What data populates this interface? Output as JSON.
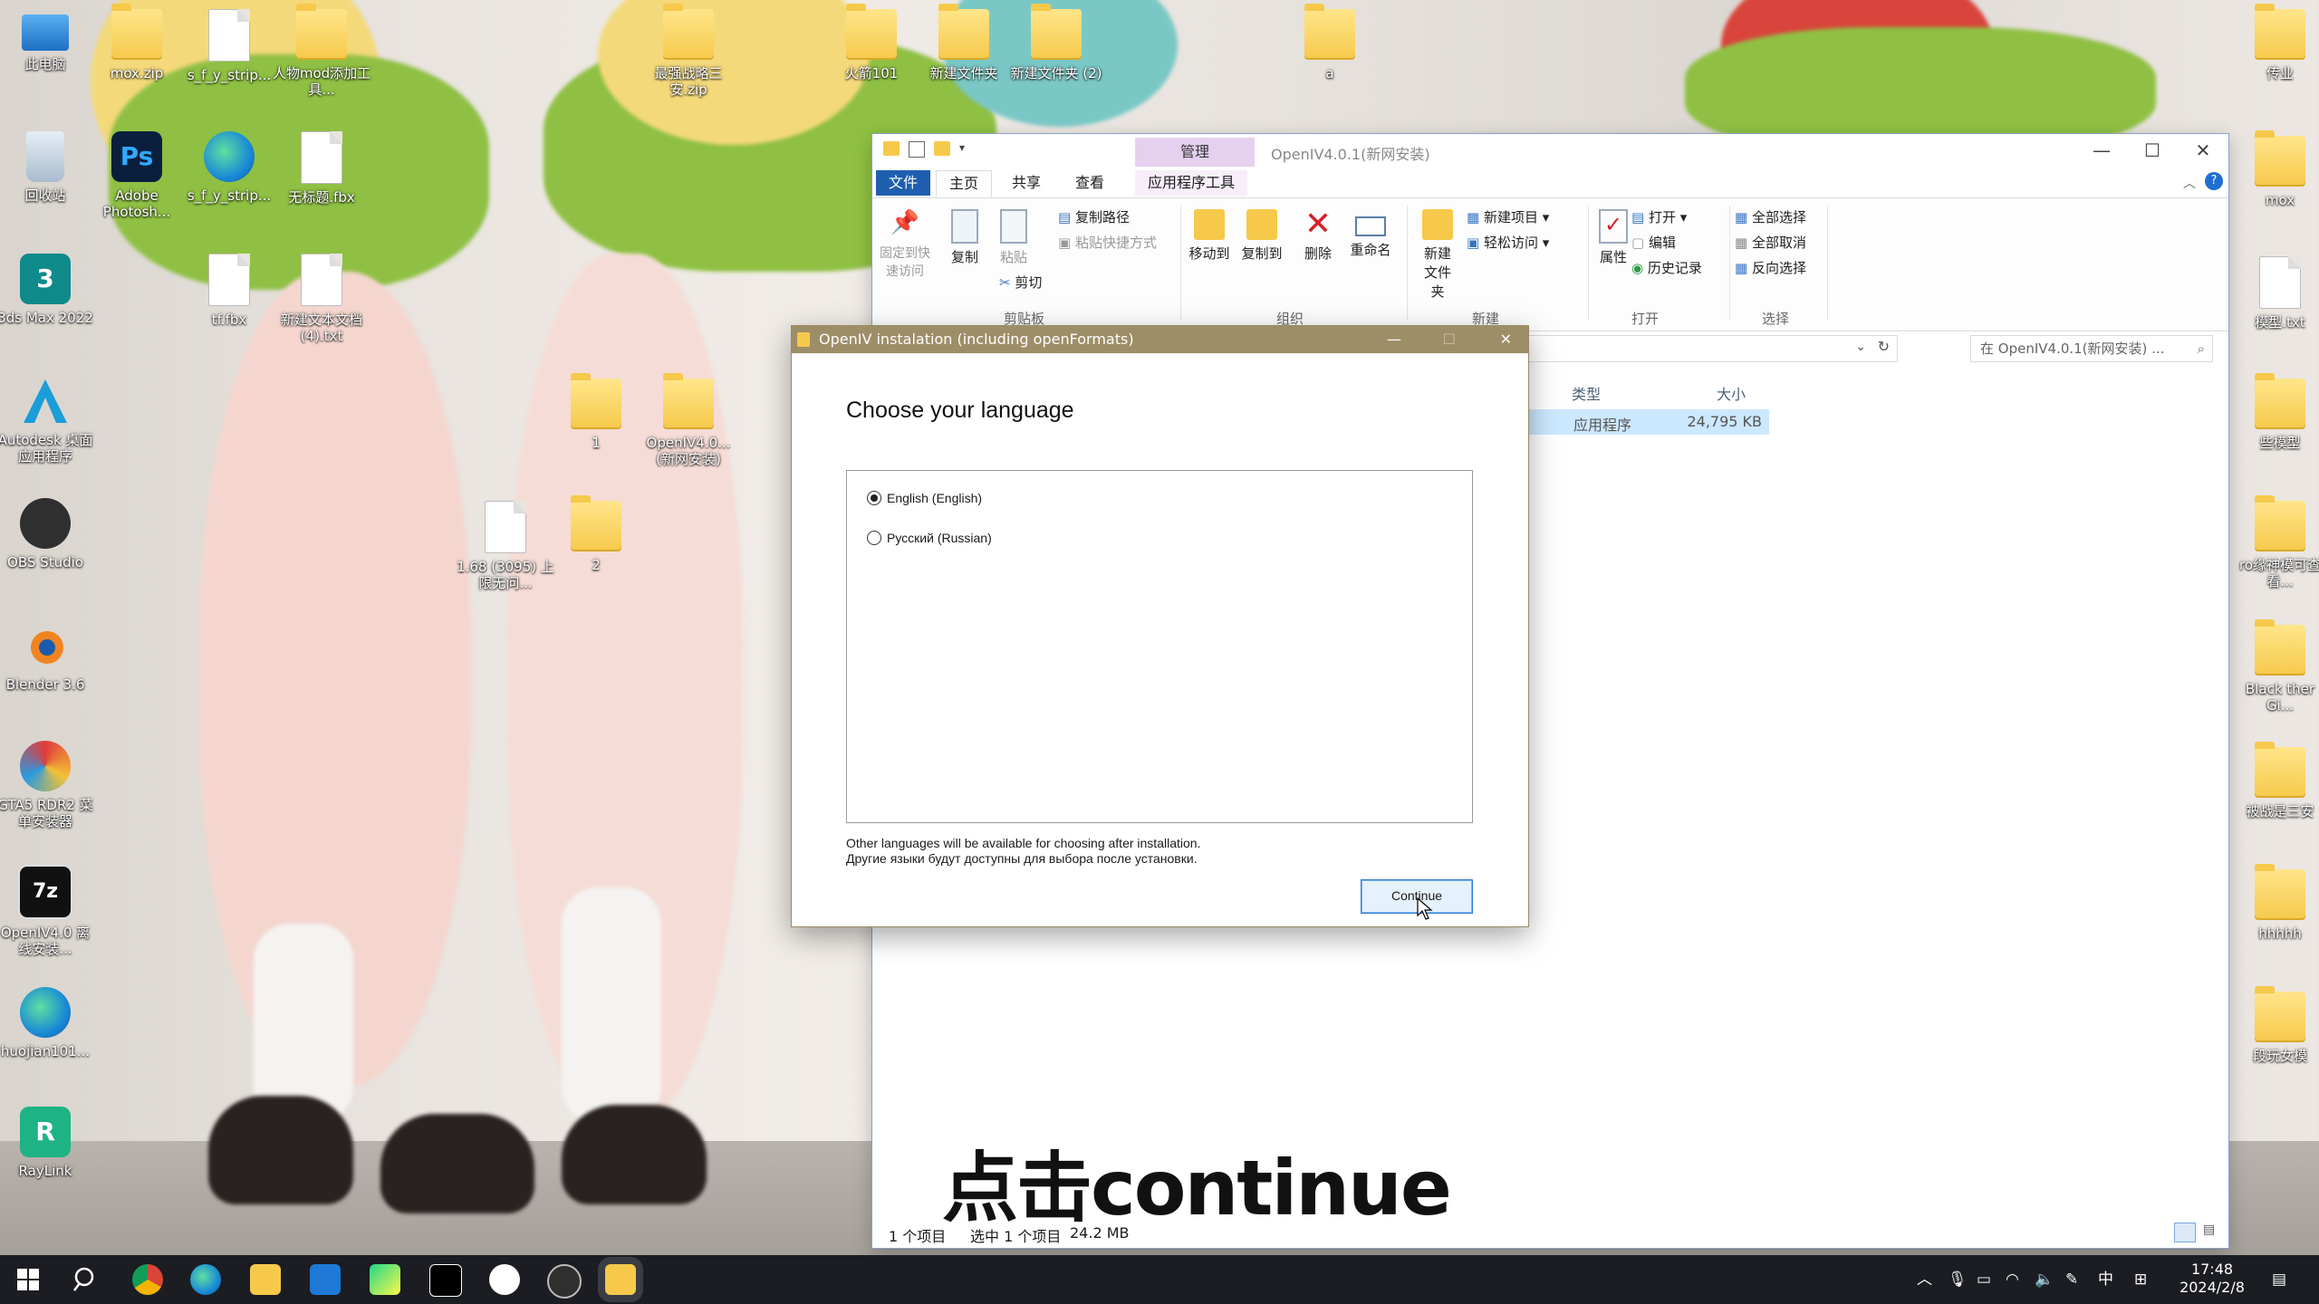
{
  "desktop": {
    "icons_left": [
      {
        "label": "此电脑",
        "icon": "computer-icon"
      },
      {
        "label": "回收站",
        "icon": "recycle-bin-icon"
      },
      {
        "label": "3ds Max 2022",
        "icon": "3dsmax-icon"
      },
      {
        "label": "Autodesk 桌面应用程序",
        "icon": "autodesk-icon"
      },
      {
        "label": "OBS Studio",
        "icon": "obs-icon"
      },
      {
        "label": "Blender 3.6",
        "icon": "blender-icon"
      },
      {
        "label": "GTA5 RDR2 菜单安装器",
        "icon": "gta-installer-icon"
      },
      {
        "label": "OpenIV4.0 离线安装...",
        "icon": "7zip-icon"
      },
      {
        "label": "huojian101...",
        "icon": "edge-icon"
      },
      {
        "label": "RayLink",
        "icon": "raylink-icon"
      }
    ],
    "icons_col2": [
      {
        "label": "mox.zip"
      },
      {
        "label": "Adobe Photosh..."
      }
    ],
    "icons_col3": [
      {
        "label": "s_f_y_strip..."
      },
      {
        "label": "s_f_y_strip..."
      },
      {
        "label": "tf.fbx"
      }
    ],
    "icons_col4": [
      {
        "label": "人物mod添加工具..."
      },
      {
        "label": "无标题.fbx"
      },
      {
        "label": "新建文本文档 (4).txt"
      }
    ],
    "icons_mid": [
      {
        "label": "最强战略三安.zip"
      },
      {
        "label": "火箭101"
      },
      {
        "label": "新建文件夹"
      },
      {
        "label": "新建文件夹 (2)"
      },
      {
        "label": "a"
      },
      {
        "label": "1"
      },
      {
        "label": "OpenIV4.0... (新网安装)"
      },
      {
        "label": "1.68 (3095) 上限无问..."
      },
      {
        "label": "2"
      }
    ],
    "icons_right": [
      {
        "label": "传业"
      },
      {
        "label": "mox"
      },
      {
        "label": "模型.txt"
      },
      {
        "label": "些模型"
      },
      {
        "label": "ro缘神模可查看..."
      },
      {
        "label": "Black ther Gi..."
      },
      {
        "label": "被战是三安"
      },
      {
        "label": "hhhhh"
      },
      {
        "label": "段玩女模"
      }
    ]
  },
  "explorer": {
    "title": "OpenIV4.0.1(新网安装)",
    "manage_tab": "管理",
    "tabs": [
      "文件",
      "主页",
      "共享",
      "查看",
      "应用程序工具"
    ],
    "ribbon": {
      "pin": "固定到快速访问",
      "copy": "复制",
      "paste": "粘贴",
      "copy_path": "复制路径",
      "paste_shortcut": "粘贴快捷方式",
      "cut": "剪切",
      "group_clipboard": "剪贴板",
      "move_to": "移动到",
      "copy_to": "复制到",
      "delete": "删除",
      "rename": "重命名",
      "group_organize": "组织",
      "new_folder": "新建文件夹",
      "new_item": "新建项目",
      "easy_access": "轻松访问",
      "group_new": "新建",
      "properties": "属性",
      "open": "打开",
      "edit": "编辑",
      "history": "历史记录",
      "group_open": "打开",
      "select_all": "全部选择",
      "select_none": "全部取消",
      "invert": "反向选择",
      "group_select": "选择"
    },
    "search_placeholder": "在 OpenIV4.0.1(新网安装) ...",
    "columns": {
      "type": "类型",
      "size": "大小"
    },
    "row": {
      "type": "应用程序",
      "size": "24,795 KB"
    },
    "status": {
      "count": "1 个项目",
      "selected": "选中 1 个项目",
      "size": "24.2 MB"
    }
  },
  "dialog": {
    "title": "OpenIV instalation (including openFormats)",
    "heading": "Choose your language",
    "options": [
      {
        "label": "English (English)",
        "selected": true
      },
      {
        "label": "Русский (Russian)",
        "selected": false
      }
    ],
    "note_en": "Other languages will be available for choosing after installation.",
    "note_ru": "Другие языки будут доступны для выбора после установки.",
    "continue_label": "Continue"
  },
  "subtitle": "点击continue",
  "taskbar": {
    "apps": [
      "start-icon",
      "search-icon",
      "chrome-icon",
      "edge-icon",
      "file-explorer-icon",
      "vscode-icon",
      "pycharm-icon",
      "capcut-icon",
      "qq-icon",
      "obs-icon",
      "openiv-installer-icon"
    ],
    "ime": "中",
    "time": "17:48",
    "date": "2024/2/8"
  },
  "colors": {
    "accent": "#2d7bd6",
    "dialog_title": "#9e8e68",
    "ribbon_file_tab": "#1f5fb0",
    "manage_tab": "#e5d0f0"
  }
}
